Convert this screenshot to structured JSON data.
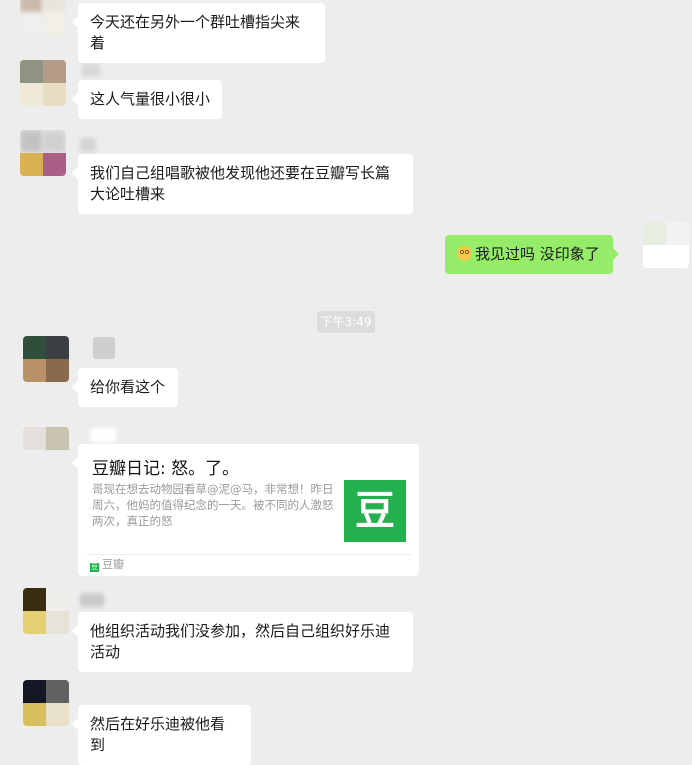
{
  "messages": [
    {
      "text": "今天还在另外一个群吐槽指尖来着"
    },
    {
      "text": "这人气量很小很小"
    },
    {
      "text": "我们自己组唱歌被他发现他还要在豆瓣写长篇大论吐槽来"
    },
    {
      "text": "我见过吗 没印象了",
      "emoji": "flushed-face-emoji"
    },
    {
      "text": "给你看这个"
    },
    {
      "text": "他组织活动我们没参加，然后自己组织好乐迪活动"
    },
    {
      "text": "然后在好乐迪被他看到"
    }
  ],
  "timestamp": "下午3:49",
  "link_card": {
    "title": "豆瓣日记: 怒。了。",
    "description": "哥现在想去动物园看草@泥@马，非常想！昨日周六，他妈的值得纪念的一天。被不同的人激怒两次，真正的怒",
    "thumb_glyph": "豆",
    "source": "豆瓣",
    "source_logo": "豆"
  },
  "colors": {
    "background": "#ededed",
    "incoming_bubble": "#ffffff",
    "outgoing_bubble": "#95ec69",
    "douban_green": "#22b14c"
  }
}
